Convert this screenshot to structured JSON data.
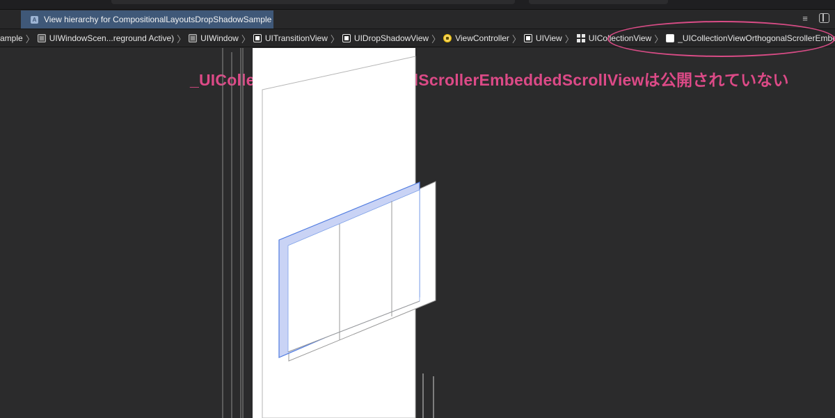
{
  "tab": {
    "title": "View hierarchy for CompositionalLayoutsDropShadowSample",
    "icon": "app-icon"
  },
  "toolbar_icons": [
    "lines-icon",
    "inspector-panel-icon"
  ],
  "breadcrumbs": [
    {
      "label": "ample",
      "icon": ""
    },
    {
      "label": "UIWindowScen...reground Active)",
      "icon": "box-dark"
    },
    {
      "label": "UIWindow",
      "icon": "box-dark"
    },
    {
      "label": "UITransitionView",
      "icon": "box-white-inner"
    },
    {
      "label": "UIDropShadowView",
      "icon": "box-white-inner"
    },
    {
      "label": "ViewController",
      "icon": "view-controller"
    },
    {
      "label": "UIView",
      "icon": "box-white-inner"
    },
    {
      "label": "UICollectionView",
      "icon": "grid"
    },
    {
      "label": "_UICollectionViewOrthogonalScrollerEmbeddedScrollView",
      "icon": "box"
    }
  ],
  "annotation": {
    "text": "_UICollectionViewOrthogonalScrollerEmbeddedScrollViewは公開されていない",
    "color": "#dc4a87"
  },
  "colors": {
    "background": "#2b2b2c",
    "tab_active": "#3f5878",
    "selection_blue": "#4f7be0",
    "selection_fill": "#c9d3f5"
  }
}
